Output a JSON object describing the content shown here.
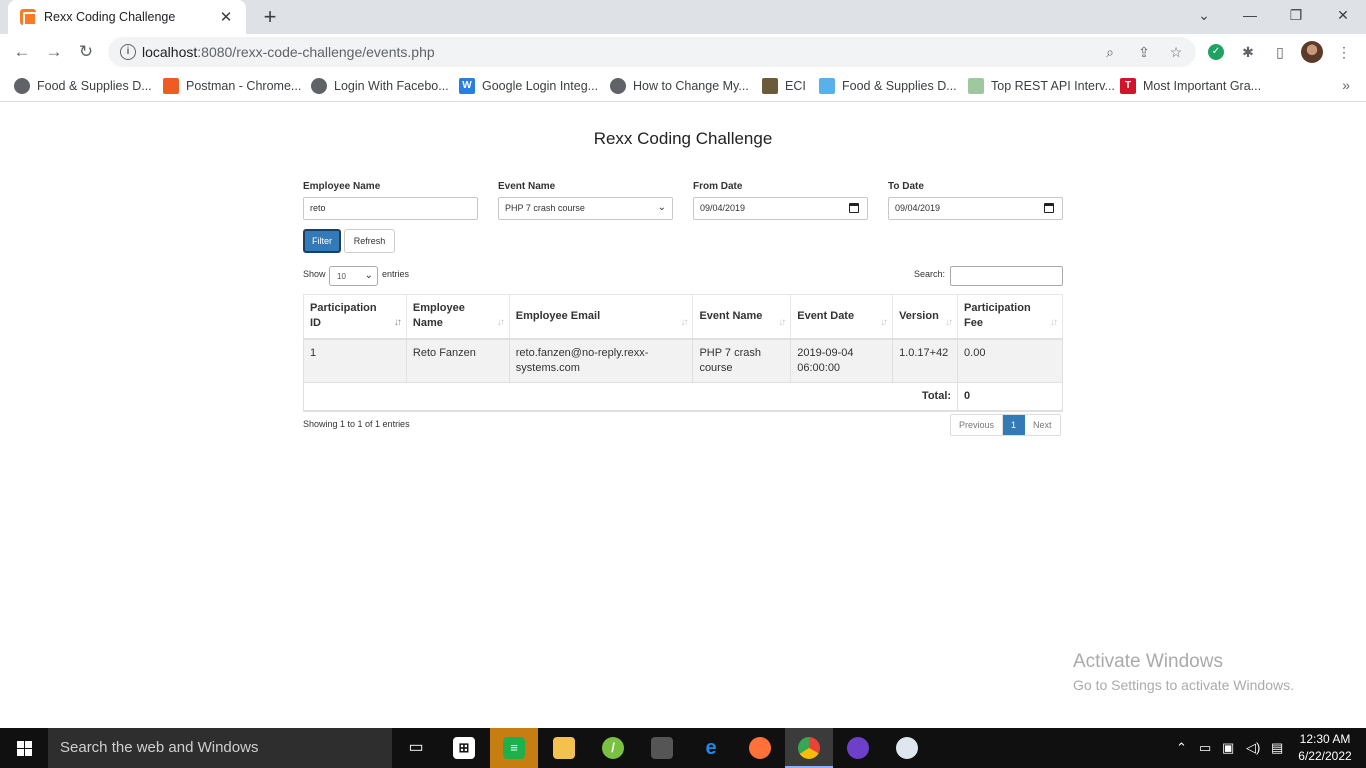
{
  "browser": {
    "tab_title": "Rexx Coding Challenge",
    "tab_close": "✕",
    "new_tab": "+",
    "window_controls": [
      "⌄",
      "—",
      "❐",
      "✕"
    ],
    "url_host": "localhost",
    "url_rest": ":8080/rexx-code-challenge/events.php",
    "bookmarks": [
      {
        "label": "Food & Supplies D...",
        "icon": "globe-icon"
      },
      {
        "label": "Postman - Chrome...",
        "icon": "postman-icon"
      },
      {
        "label": "Login With Facebo...",
        "icon": "globe-icon"
      },
      {
        "label": "Google Login Integ...",
        "icon": "w-icon"
      },
      {
        "label": "How to Change My...",
        "icon": "globe-icon"
      },
      {
        "label": "ECI",
        "icon": "eci-icon"
      },
      {
        "label": "Food & Supplies D...",
        "icon": "drink-icon"
      },
      {
        "label": "Top REST API Interv...",
        "icon": "chart-icon"
      },
      {
        "label": "Most Important Gra...",
        "icon": "t-icon"
      }
    ]
  },
  "page": {
    "title": "Rexx Coding Challenge",
    "filters": {
      "employee_name_label": "Employee Name",
      "employee_name_value": "reto",
      "event_name_label": "Event Name",
      "event_name_value": "PHP 7 crash course",
      "from_date_label": "From Date",
      "from_date_value": "09/04/2019",
      "to_date_label": "To Date",
      "to_date_value": "09/04/2019"
    },
    "buttons": {
      "filter": "Filter",
      "refresh": "Refresh"
    },
    "length": {
      "show": "Show",
      "value": "10",
      "entries": "entries"
    },
    "search_label": "Search:",
    "table": {
      "columns": [
        {
          "line1": "Participation",
          "line2": "ID",
          "sort": "↓↑"
        },
        {
          "line1": "Employee",
          "line2": "Name",
          "sort": "↓↑"
        },
        {
          "line1": "Employee Email",
          "line2": "",
          "sort": "↓↑"
        },
        {
          "line1": "Event Name",
          "line2": "",
          "sort": "↓↑"
        },
        {
          "line1": "Event Date",
          "line2": "",
          "sort": "↓↑"
        },
        {
          "line1": "Version",
          "line2": "",
          "sort": "↓↑"
        },
        {
          "line1": "Participation",
          "line2": "Fee",
          "sort": "↓↑"
        }
      ],
      "rows": [
        {
          "id": "1",
          "employee_name": "Reto Fanzen",
          "email_1": "reto.fanzen@no-reply.rexx-",
          "email_2": "systems.com",
          "event_1": "PHP 7 crash",
          "event_2": "course",
          "date_1": "2019-09-04",
          "date_2": "06:00:00",
          "version": "1.0.17+42",
          "fee": "0.00"
        }
      ],
      "total_label": "Total:",
      "total_value": "0"
    },
    "info": "Showing 1 to 1 of 1 entries",
    "pagination": {
      "previous": "Previous",
      "current": "1",
      "next": "Next"
    }
  },
  "watermark": {
    "title": "Activate Windows",
    "subtitle": "Go to Settings to activate Windows."
  },
  "taskbar": {
    "search_placeholder": "Search the web and Windows",
    "time": "12:30 AM",
    "date": "6/22/2022"
  }
}
